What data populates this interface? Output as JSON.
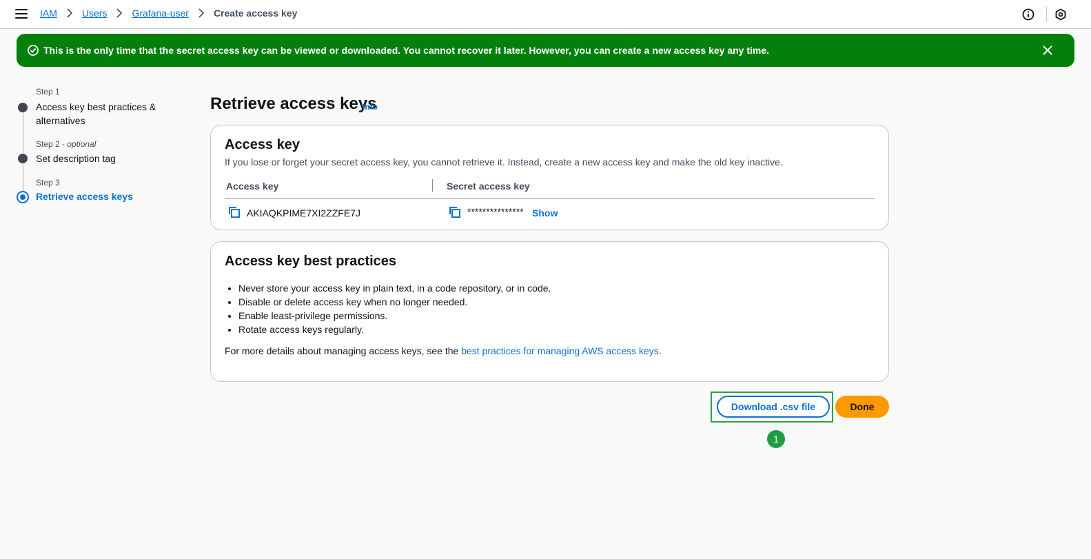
{
  "breadcrumb": {
    "items": [
      {
        "label": "IAM"
      },
      {
        "label": "Users"
      },
      {
        "label": "Grafana-user"
      }
    ],
    "current": "Create access key"
  },
  "flash": {
    "message": "This is the only time that the secret access key can be viewed or downloaded. You cannot recover it later. However, you can create a new access key any time.",
    "type": "success",
    "color": "#037f0c"
  },
  "steps": [
    {
      "number": "Step 1",
      "optional": "",
      "title": "Access key best practices & alternatives",
      "state": "completed"
    },
    {
      "number": "Step 2 - ",
      "optional": "optional",
      "title": "Set description tag",
      "state": "completed"
    },
    {
      "number": "Step 3",
      "optional": "",
      "title": "Retrieve access keys",
      "state": "active"
    }
  ],
  "page": {
    "title": "Retrieve access keys",
    "info_label": "Info"
  },
  "access_key_card": {
    "title": "Access key",
    "description": "If you lose or forget your secret access key, you cannot retrieve it. Instead, create a new access key and make the old key inactive.",
    "col_access_key": "Access key",
    "col_secret_key": "Secret access key",
    "access_key_value": "AKIAQKPIME7XI2ZZFE7J",
    "secret_key_masked": "***************",
    "show_label": "Show"
  },
  "best_practices_card": {
    "title": "Access key best practices",
    "items": [
      "Never store your access key in plain text, in a code repository, or in code.",
      "Disable or delete access key when no longer needed.",
      "Enable least-privilege permissions.",
      "Rotate access keys regularly."
    ],
    "more_prefix": "For more details about managing access keys, see the ",
    "more_link": "best practices for managing AWS access keys",
    "more_suffix": "."
  },
  "actions": {
    "download_label": "Download .csv file",
    "done_label": "Done",
    "marker_label": "1"
  },
  "colors": {
    "link": "#0972d3",
    "primary_button": "#ff9900",
    "highlight": "#2ea043"
  },
  "icons": {
    "menu": "hamburger-menu-icon",
    "info": "info-circle-icon",
    "notifications": "hexagon-settings-icon",
    "success": "check-circle-icon",
    "dismiss": "close-icon",
    "copy": "copy-icon"
  }
}
